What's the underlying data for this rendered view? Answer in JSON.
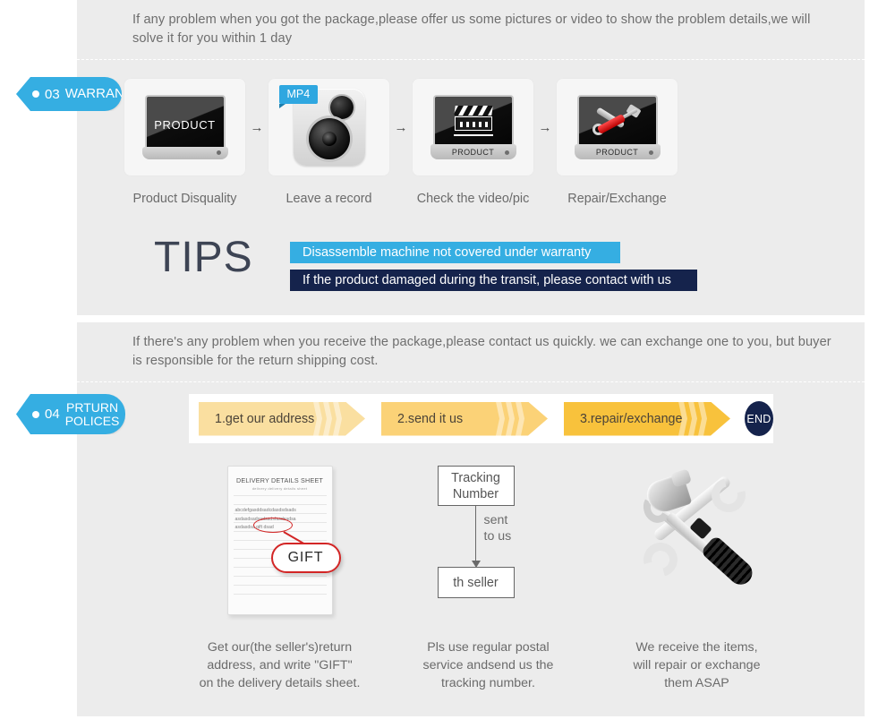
{
  "warranty": {
    "tag": {
      "number": "03",
      "label": "WARRANTY"
    },
    "intro": "If any problem when you got the package,please offer us some pictures or video to show the problem details,we will solve it for you within 1 day",
    "steps": [
      {
        "label": "Product Disquality",
        "icon": "monitor-icon",
        "screen_text": "PRODUCT"
      },
      {
        "label": "Leave a record",
        "icon": "camera-icon",
        "badge": "MP4"
      },
      {
        "label": "Check the video/pic",
        "icon": "clapperboard-icon",
        "base_text": "PRODUCT"
      },
      {
        "label": "Repair/Exchange",
        "icon": "tools-icon",
        "base_text": "PRODUCT"
      }
    ],
    "arrow": "→",
    "tips": {
      "heading": "TIPS",
      "bars": [
        {
          "text": "Disassemble machine not covered under warranty",
          "color": "#35aee2"
        },
        {
          "text": "If the product damaged during the transit, please contact with us",
          "color": "#15234c"
        }
      ]
    }
  },
  "returns": {
    "tag": {
      "number": "04",
      "label_line1": "PRTURN",
      "label_line2": "POLICES"
    },
    "intro": "If  there's any problem when you receive the package,please contact us quickly. we can exchange one to you, but buyer is responsible for the return shipping cost.",
    "flow": [
      {
        "label": "1.get our address",
        "color": "#fadfa0"
      },
      {
        "label": "2.send it us",
        "color": "#fbd277"
      },
      {
        "label": "3.repair/exchange",
        "color": "#f8c23c"
      }
    ],
    "end_badge": "END",
    "columns": [
      {
        "art": "delivery-sheet",
        "sheet_title": "DELIVERY DETAILS SHEET",
        "sheet_sub": "delivery            delivery details sheet",
        "sheet_body": "abcdefgasddsadcdasdsdsads\nasdasdsadsadsadsfasdsadsa\nasdasdsa  gift  dsad",
        "bubble_text": "GIFT",
        "caption": "Get our(the seller's)return\naddress, and write \"GIFT\"\non the delivery details sheet."
      },
      {
        "art": "tracking-flow",
        "box_top": "Tracking\nNumber",
        "arrow_label": "sent\nto us",
        "box_bottom": "th seller",
        "caption": "Pls use regular postal\nservice andsend us the\ntracking number."
      },
      {
        "art": "tools",
        "caption": "We receive the items,\nwill repair or exchange\nthem ASAP"
      }
    ]
  },
  "colors": {
    "accent_blue": "#35aee2",
    "dark_navy": "#15234c",
    "panel_gray": "#ececec",
    "text_gray": "#6b6b6b"
  }
}
